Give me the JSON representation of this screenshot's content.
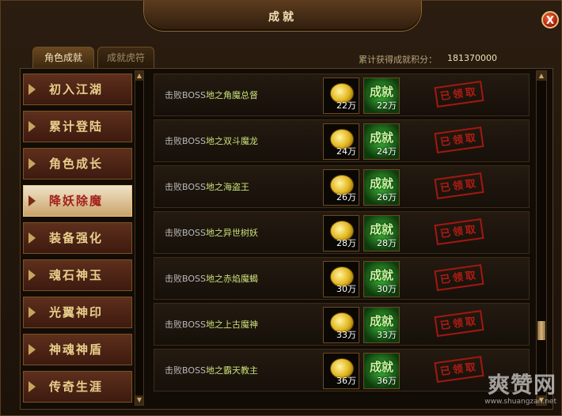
{
  "window": {
    "title": "成就",
    "close_label": "X"
  },
  "tabs": [
    {
      "label": "角色成就",
      "active": true
    },
    {
      "label": "成就虎符",
      "active": false
    }
  ],
  "points": {
    "label": "累计获得成就积分：",
    "value": "181370000"
  },
  "nav": {
    "items": [
      {
        "label": "初入江湖",
        "active": false
      },
      {
        "label": "累计登陆",
        "active": false
      },
      {
        "label": "角色成长",
        "active": false
      },
      {
        "label": "降妖除魔",
        "active": true
      },
      {
        "label": "装备强化",
        "active": false
      },
      {
        "label": "魂石神玉",
        "active": false
      },
      {
        "label": "光翼神印",
        "active": false
      },
      {
        "label": "神魂神盾",
        "active": false
      },
      {
        "label": "传奇生涯",
        "active": false
      }
    ]
  },
  "achievements": {
    "rows": [
      {
        "prefix": "击败BOSS",
        "name": "地之角魔总督",
        "gold": "22万",
        "score_icon": "成就",
        "score": "22万",
        "status": "已领取"
      },
      {
        "prefix": "击败BOSS",
        "name": "地之双斗魔龙",
        "gold": "24万",
        "score_icon": "成就",
        "score": "24万",
        "status": "已领取"
      },
      {
        "prefix": "击败BOSS",
        "name": "地之海盗王",
        "gold": "26万",
        "score_icon": "成就",
        "score": "26万",
        "status": "已领取"
      },
      {
        "prefix": "击败BOSS",
        "name": "地之异世树妖",
        "gold": "28万",
        "score_icon": "成就",
        "score": "28万",
        "status": "已领取"
      },
      {
        "prefix": "击败BOSS",
        "name": "地之赤焰魔蝎",
        "gold": "30万",
        "score_icon": "成就",
        "score": "30万",
        "status": "已领取"
      },
      {
        "prefix": "击败BOSS",
        "name": "地之上古魔神",
        "gold": "33万",
        "score_icon": "成就",
        "score": "33万",
        "status": "已领取"
      },
      {
        "prefix": "击败BOSS",
        "name": "地之霸天教主",
        "gold": "36万",
        "score_icon": "成就",
        "score": "36万",
        "status": "已领取"
      }
    ]
  },
  "watermark": {
    "main": "爽赞网",
    "sub": "www.shuangzan.net"
  }
}
